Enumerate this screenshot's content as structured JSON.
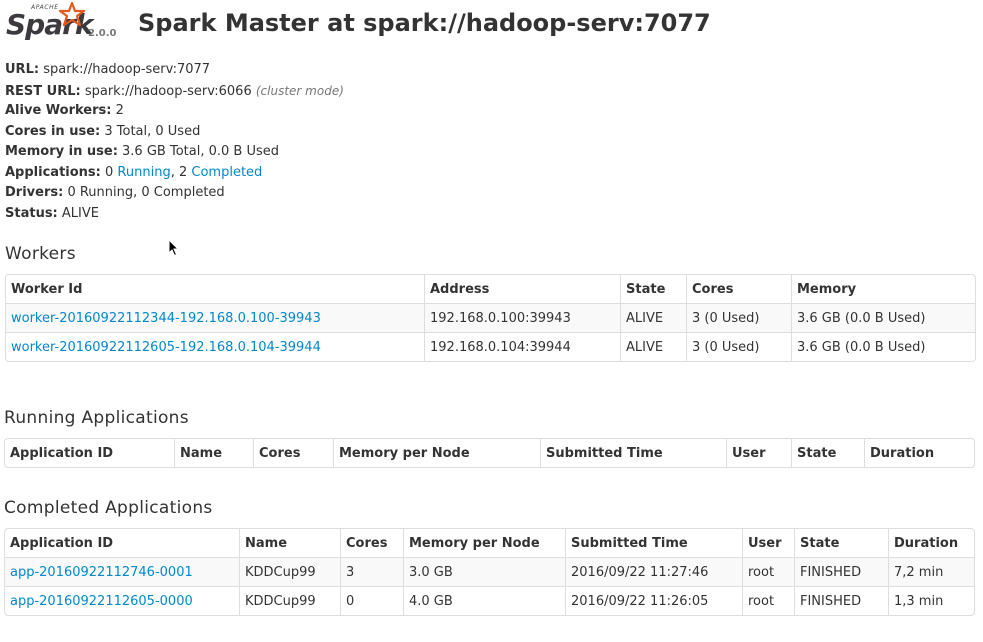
{
  "header": {
    "logo_top": "APACHE",
    "logo_word": "Spark",
    "version": "2.0.0",
    "title": "Spark Master at spark://hadoop-serv:7077"
  },
  "summary": {
    "url_label": "URL:",
    "url_value": "spark://hadoop-serv:7077",
    "rest_label": "REST URL:",
    "rest_value": "spark://hadoop-serv:6066",
    "rest_mode": "(cluster mode)",
    "alive_label": "Alive Workers:",
    "alive_value": "2",
    "cores_label": "Cores in use:",
    "cores_value": "3 Total, 0 Used",
    "memory_label": "Memory in use:",
    "memory_value": "3.6 GB Total, 0.0 B Used",
    "apps_label": "Applications:",
    "apps_running_count": "0",
    "apps_running_link": "Running",
    "apps_sep": ", 2",
    "apps_completed_link": "Completed",
    "drivers_label": "Drivers:",
    "drivers_value": "0 Running, 0 Completed",
    "status_label": "Status:",
    "status_value": "ALIVE"
  },
  "workers": {
    "title": "Workers",
    "headers": [
      "Worker Id",
      "Address",
      "State",
      "Cores",
      "Memory"
    ],
    "rows": [
      [
        "worker-20160922112344-192.168.0.100-39943",
        "192.168.0.100:39943",
        "ALIVE",
        "3 (0 Used)",
        "3.6 GB (0.0 B Used)"
      ],
      [
        "worker-20160922112605-192.168.0.104-39944",
        "192.168.0.104:39944",
        "ALIVE",
        "3 (0 Used)",
        "3.6 GB (0.0 B Used)"
      ]
    ]
  },
  "running": {
    "title": "Running Applications",
    "headers": [
      "Application ID",
      "Name",
      "Cores",
      "Memory per Node",
      "Submitted Time",
      "User",
      "State",
      "Duration"
    ]
  },
  "completed": {
    "title": "Completed Applications",
    "headers": [
      "Application ID",
      "Name",
      "Cores",
      "Memory per Node",
      "Submitted Time",
      "User",
      "State",
      "Duration"
    ],
    "rows": [
      [
        "app-20160922112746-0001",
        "KDDCup99",
        "3",
        "3.0 GB",
        "2016/09/22 11:27:46",
        "root",
        "FINISHED",
        "7,2 min"
      ],
      [
        "app-20160922112605-0000",
        "KDDCup99",
        "0",
        "4.0 GB",
        "2016/09/22 11:26:05",
        "root",
        "FINISHED",
        "1,3 min"
      ]
    ]
  },
  "colors": {
    "link": "#0088cc",
    "logo_star": "#e25a1c",
    "text": "#333333"
  }
}
